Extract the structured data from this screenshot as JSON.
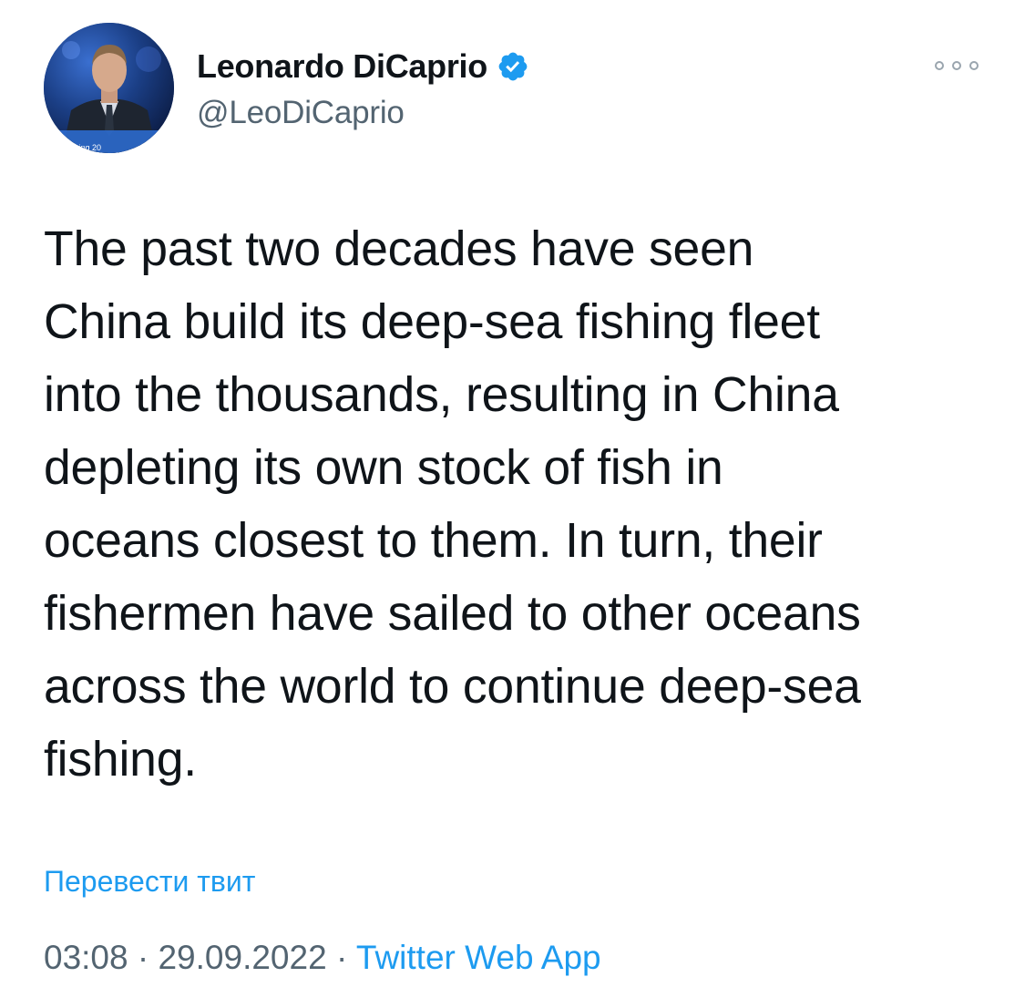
{
  "author": {
    "display_name": "Leonardo DiCaprio",
    "handle": "@LeoDiCaprio",
    "verified": true,
    "avatar_banner_text": "ual Meeting 20"
  },
  "tweet": {
    "text": "The past two decades have seen\nChina build its deep-sea fishing fleet\ninto the thousands, resulting in China\ndepleting its own stock of fish in\noceans closest to them. In turn, their\nfishermen have sailed to other oceans\nacross the world to continue deep-sea\nfishing.",
    "translate_label": "Перевести твит",
    "time": "03:08",
    "separator": "·",
    "date": "29.09.2022",
    "source": "Twitter Web App"
  },
  "icons": {
    "verified": "verified-badge-icon",
    "more": "more-options-icon"
  },
  "colors": {
    "link": "#1d9bf0",
    "text": "#0f1419",
    "secondary": "#536471",
    "verified": "#1d9bf0"
  }
}
